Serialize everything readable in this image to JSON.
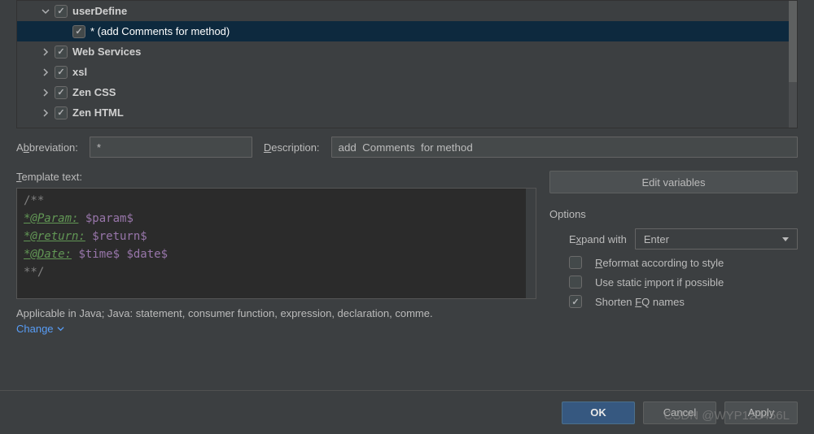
{
  "tree": {
    "items": [
      {
        "label": "userDefine",
        "expanded": true,
        "checked": true,
        "depth": 1,
        "bold": true,
        "selected": false
      },
      {
        "label": "* (add  Comments  for method)",
        "expanded": null,
        "checked": true,
        "depth": 2,
        "bold": false,
        "selected": true
      },
      {
        "label": "Web Services",
        "expanded": false,
        "checked": true,
        "depth": 1,
        "bold": true,
        "selected": false
      },
      {
        "label": "xsl",
        "expanded": false,
        "checked": true,
        "depth": 1,
        "bold": true,
        "selected": false
      },
      {
        "label": "Zen CSS",
        "expanded": false,
        "checked": true,
        "depth": 1,
        "bold": true,
        "selected": false
      },
      {
        "label": "Zen HTML",
        "expanded": false,
        "checked": true,
        "depth": 1,
        "bold": true,
        "selected": false
      }
    ]
  },
  "form": {
    "abbreviation_label_pre": "A",
    "abbreviation_label_u": "b",
    "abbreviation_label_post": "breviation:",
    "abbreviation_value": "*",
    "description_label_u": "D",
    "description_label_post": "escription:",
    "description_value": "add  Comments  for method",
    "template_text_label_u": "T",
    "template_text_label_post": "emplate text:"
  },
  "editor": {
    "line1": "/**",
    "line2_kw": "*@Param:",
    "line2_var": "  $param$",
    "line3_kw": "*@return:",
    "line3_var": " $return$",
    "line4_kw": "*@Date:",
    "line4_var": " $time$ $date$",
    "line5": "**/"
  },
  "applicable": {
    "text": "Applicable in Java; Java: statement, consumer function, expression, declaration, comme.",
    "change_label": "Change"
  },
  "right": {
    "edit_variables_pre": "",
    "edit_variables_u": "E",
    "edit_variables_post": "dit variables",
    "options_title": "Options",
    "expand_with_pre": "E",
    "expand_with_u": "x",
    "expand_with_post": "pand with",
    "expand_with_value": "Enter",
    "reformat_checked": false,
    "reformat_u": "R",
    "reformat_post": "eformat according to style",
    "static_checked": false,
    "static_pre": "Use static ",
    "static_u": "i",
    "static_post": "mport if possible",
    "shorten_checked": true,
    "shorten_pre": "Shorten ",
    "shorten_u": "F",
    "shorten_post": "Q names"
  },
  "footer": {
    "ok": "OK",
    "cancel": "Cancel",
    "apply": "Apply"
  },
  "watermark": "CSDN @WYP123456L"
}
